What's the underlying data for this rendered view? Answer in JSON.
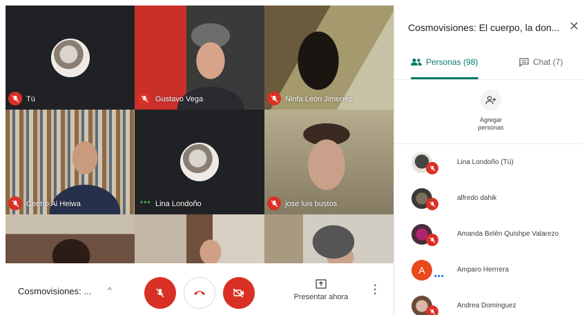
{
  "tiles": [
    {
      "name": "Tú",
      "muted": true
    },
    {
      "name": "Gustavo Vega",
      "muted": true
    },
    {
      "name": "Ninfa León Jimenez",
      "muted": true
    },
    {
      "name": "Centro Ai Heiwa",
      "muted": true
    },
    {
      "name": "Lina Londoño",
      "muted": false
    },
    {
      "name": "jose luis bustos",
      "muted": true
    }
  ],
  "bottombar": {
    "meeting_title": "Cosmovisiones: ...",
    "present_label": "Presentar ahora"
  },
  "panel": {
    "title": "Cosmovisiones: El cuerpo, la don...",
    "tab_people": "Personas (98)",
    "tab_chat": "Chat (7)",
    "add_label_1": "Agregar",
    "add_label_2": "personas",
    "people": [
      {
        "name": "Lina Londoño (Tú)"
      },
      {
        "name": "alfredo dahik"
      },
      {
        "name": "Amanda Belén Quishpe Valarezo"
      },
      {
        "name": "Amparo Herrrera",
        "initial": "A"
      },
      {
        "name": "Andrea Dominguez"
      }
    ]
  },
  "colors": {
    "accent": "#00796b",
    "danger": "#d93025",
    "speaking": "#34a853"
  }
}
